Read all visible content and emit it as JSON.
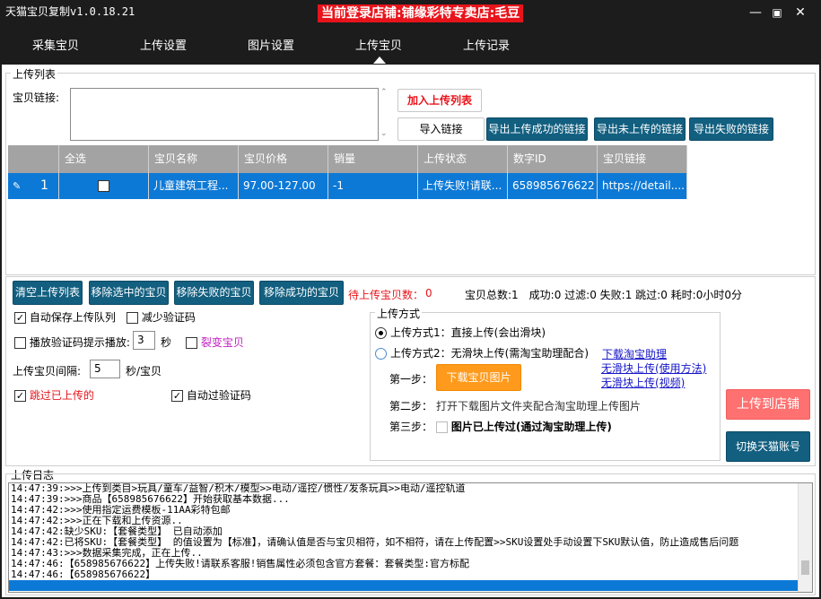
{
  "titlebar": {
    "app_title": "天猫宝贝复制v1.0.18.21",
    "store_banner": "当前登录店铺:铺缘彩特专卖店:毛豆",
    "min_icon": "minimize-icon",
    "max_icon": "maximize-icon",
    "close_icon": "close-icon"
  },
  "nav": {
    "tabs": [
      {
        "label": "采集宝贝"
      },
      {
        "label": "上传设置"
      },
      {
        "label": "图片设置"
      },
      {
        "label": "上传宝贝"
      },
      {
        "label": "上传记录"
      }
    ],
    "active": "上传宝贝"
  },
  "upload_list": {
    "group_label": "上传列表",
    "url_label": "宝贝链接:",
    "url_value": "",
    "add_button": "加入上传列表",
    "import_button": "导入链接",
    "export_success_button": "导出上传成功的链接",
    "export_not_uploaded_button": "导出未上传的链接",
    "export_failed_button": "导出失败的链接"
  },
  "grid": {
    "headers": [
      "全选",
      "宝贝名称",
      "宝贝价格",
      "销量",
      "上传状态",
      "数字ID",
      "宝贝链接"
    ],
    "rows": [
      {
        "index": "1",
        "checked": false,
        "name": "儿童建筑工程...",
        "price": "97.00-127.00",
        "sales": "-1",
        "status": "上传失败!请联...",
        "id": "658985676622",
        "url": "https://detail...."
      }
    ]
  },
  "actions": {
    "clear_button": "清空上传列表",
    "remove_selected_button": "移除选中的宝贝",
    "remove_failed_button": "移除失败的宝贝",
    "remove_success_button": "移除成功的宝贝",
    "pending_label": "待上传宝贝数：",
    "pending_value": "0",
    "stats": "宝贝总数:1　成功:0 过滤:0 失败:1 跳过:0 耗时:0小时0分"
  },
  "options": {
    "auto_save_queue": {
      "label": "自动保存上传队列",
      "checked": true
    },
    "reduce_captcha": {
      "label": "减少验证码",
      "checked": false
    },
    "play_captcha_sound": {
      "label": "播放验证码提示播放:",
      "checked": false
    },
    "captcha_seconds": "3",
    "seconds_unit": "秒",
    "fission": {
      "label": "裂变宝贝",
      "checked": false
    },
    "interval_label": "上传宝贝间隔:",
    "interval_value": "5",
    "interval_unit": "秒/宝贝",
    "skip_uploaded": {
      "label": "跳过已上传的",
      "checked": true
    },
    "auto_captcha": {
      "label": "自动过验证码",
      "checked": true
    }
  },
  "upload_method": {
    "group_label": "上传方式",
    "method1": {
      "label": "上传方式1：直接上传(会出滑块)",
      "selected": true
    },
    "method2": {
      "label": "上传方式2：无滑块上传(需淘宝助理配合)",
      "selected": false
    },
    "link_download_assistant": "下载淘宝助理",
    "link_usage": "无滑块上传(使用方法)",
    "link_video": "无滑块上传(视频)",
    "step1_label": "第一步：",
    "step1_button": "下载宝贝图片",
    "step2_label": "第二步：",
    "step2_text": "打开下载图片文件夹配合淘宝助理上传图片",
    "step3_label": "第三步：",
    "step3_checkbox": "图片已上传过(通过淘宝助理上传)"
  },
  "right_buttons": {
    "upload_to_store": "上传到店铺",
    "switch_account": "切换天猫账号"
  },
  "log": {
    "group_label": "上传日志",
    "lines": [
      "14:47:39:>>>上传到类目>玩具/童车/益智/积木/模型>>电动/遥控/惯性/发条玩具>>电动/遥控轨道",
      "14:47:39:>>>商品【658985676622】开始获取基本数据...",
      "14:47:42:>>>使用指定运费模板-11AA彩特包邮",
      "14:47:42:>>>正在下载和上传资源..",
      "14:47:42:缺少SKU:【套餐类型】 已自动添加",
      "14:47:42:已将SKU:【套餐类型】 的值设置为【标准】，请确认值是否与宝贝相符，如不相符，请在上传配置>>SKU设置处手动设置下SKU默认值，防止造成售后问题",
      "14:47:43:>>>数据采集完成，正在上传..",
      "14:47:46:【658985676622】上传失败!请联系客服!销售属性必须包含官方套餐：套餐类型:官方标配",
      "14:47:46:【658985676622】"
    ]
  }
}
